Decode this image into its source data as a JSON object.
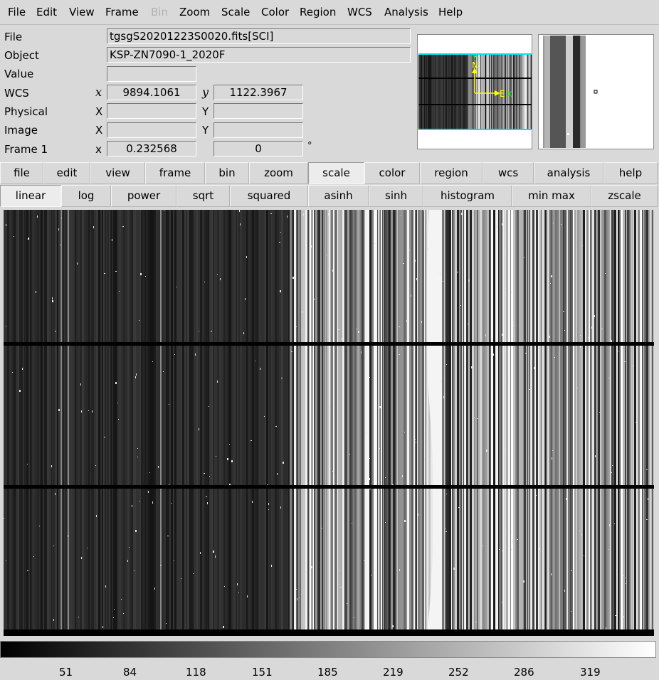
{
  "menubar": {
    "items": [
      {
        "label": "File",
        "disabled": false
      },
      {
        "label": "Edit",
        "disabled": false
      },
      {
        "label": "View",
        "disabled": false
      },
      {
        "label": "Frame",
        "disabled": false
      },
      {
        "label": "Bin",
        "disabled": true
      },
      {
        "label": "Zoom",
        "disabled": false
      },
      {
        "label": "Scale",
        "disabled": false
      },
      {
        "label": "Color",
        "disabled": false
      },
      {
        "label": "Region",
        "disabled": false
      },
      {
        "label": "WCS",
        "disabled": false
      },
      {
        "label": "Analysis",
        "disabled": false
      },
      {
        "label": "Help",
        "disabled": false
      }
    ]
  },
  "info": {
    "file_label": "File",
    "file_value": "tgsgS20201223S0020.fits[SCI]",
    "object_label": "Object",
    "object_value": "KSP-ZN7090-1_2020F",
    "value_label": "Value",
    "value_value": "",
    "wcs_label": "WCS",
    "wcs_x_axis": "x",
    "wcs_x": "9894.1061",
    "wcs_y_axis": "y",
    "wcs_y": "1122.3967",
    "physical_label": "Physical",
    "physical_x_axis": "X",
    "physical_x": "",
    "physical_y_axis": "Y",
    "physical_y": "",
    "image_label": "Image",
    "image_x_axis": "X",
    "image_x": "",
    "image_y_axis": "Y",
    "image_y": "",
    "frame_label": "Frame 1",
    "frame_x_axis": "x",
    "frame_zoom": "0.232568",
    "frame_angle": "0",
    "frame_angle_unit": "°"
  },
  "panner": {
    "north_label": "N",
    "east_label": "E",
    "y_label": "Y",
    "x_label": "X"
  },
  "buttons_main": [
    "file",
    "edit",
    "view",
    "frame",
    "bin",
    "zoom",
    "scale",
    "color",
    "region",
    "wcs",
    "analysis",
    "help"
  ],
  "buttons_main_active": "scale",
  "buttons_scale": [
    "linear",
    "log",
    "power",
    "sqrt",
    "squared",
    "asinh",
    "sinh",
    "histogram",
    "min max",
    "zscale"
  ],
  "colorbar": {
    "labels": [
      "51",
      "84",
      "118",
      "151",
      "185",
      "219",
      "252",
      "286",
      "319"
    ]
  },
  "colors": {
    "background": "#d9d9d9",
    "panner_box": "#00e5ee",
    "compass_yellow": "#ffff00",
    "compass_green": "#00ff00"
  }
}
